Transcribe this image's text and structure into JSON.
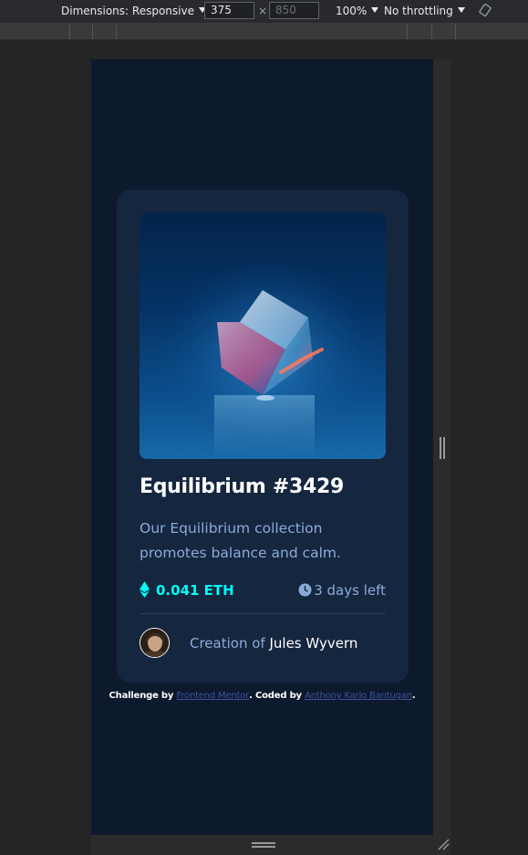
{
  "devtools": {
    "dimensions_label": "Dimensions: Responsive",
    "width_value": "375",
    "times_symbol": "×",
    "height_placeholder": "850",
    "zoom": "100%",
    "throttling": "No throttling",
    "icons": {
      "rotate": "rotate-icon",
      "dropdown": "dropdown-triangle-icon"
    }
  },
  "card": {
    "title": "Equilibrium #3429",
    "description": "Our Equilibrium collection promotes balance and calm.",
    "price": "0.041 ETH",
    "time_left": "3 days left",
    "creation_prefix": "Creation of",
    "creator_name": "Jules Wyvern",
    "icons": {
      "eth": "ethereum-icon",
      "clock": "clock-icon"
    }
  },
  "attribution": {
    "prefix": "Challenge by",
    "challenge_link": "Frontend Mentor",
    "middle": ". Coded by",
    "author_link": "Anthony Karlo Bantugan",
    "suffix": "."
  },
  "colors": {
    "page_bg": "#0d192c",
    "card_bg": "#15263f",
    "cyan": "#00fff8",
    "soft_blue": "#8bacd9",
    "white": "#ffffff",
    "link": "#3e52a3"
  }
}
